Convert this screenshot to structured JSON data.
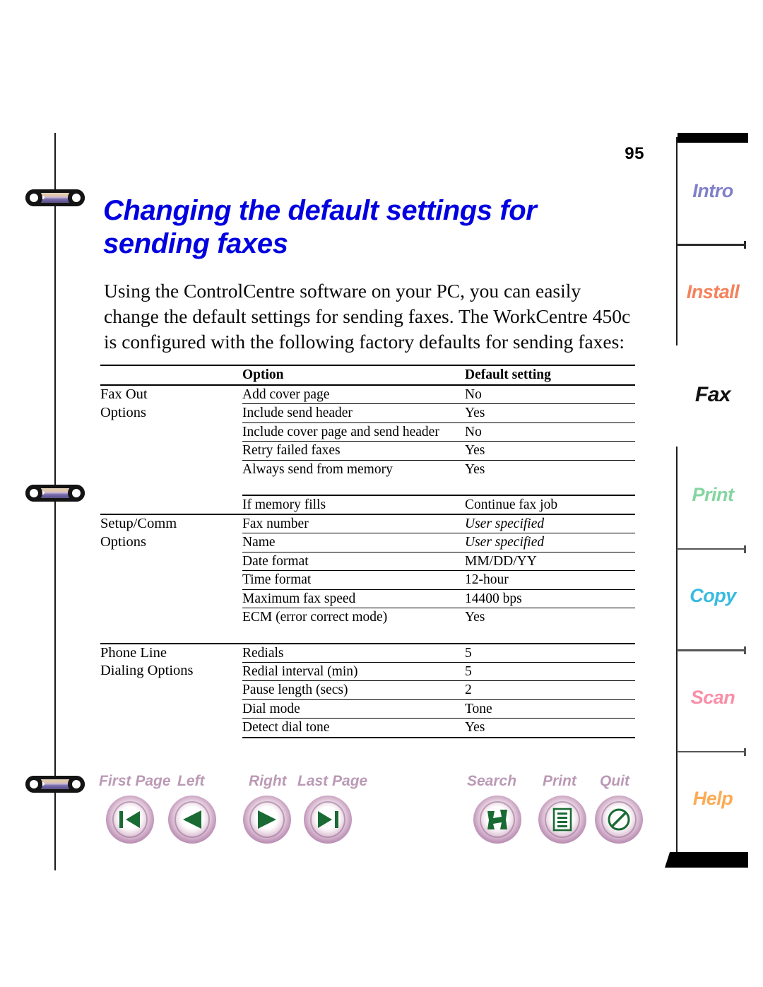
{
  "page": {
    "number": "95",
    "title_line1": "Changing the default settings for",
    "title_line2": "sending faxes",
    "intro": "Using the ControlCentre software on your PC, you can easily change the default settings for sending faxes. The WorkCentre 450c is configured with the following factory defaults for sending faxes:",
    "title_color": "#0000E0"
  },
  "table": {
    "headers": [
      "",
      "Option",
      "Default setting"
    ],
    "groups": [
      {
        "label_line1": "Fax Out",
        "label_line2": "Options",
        "rows": [
          {
            "option": "Add cover page",
            "default": "No",
            "italic": false
          },
          {
            "option": "Include send header",
            "default": "Yes",
            "italic": false
          },
          {
            "option": "Include cover page and send header",
            "default": "No",
            "italic": false
          },
          {
            "option": "Retry failed faxes",
            "default": "Yes",
            "italic": false
          },
          {
            "option": "Always send from memory",
            "default": "Yes",
            "italic": false
          }
        ]
      },
      {
        "label_line1": "",
        "label_line2": "",
        "rows": [
          {
            "option": "If memory fills",
            "default": "Continue fax job",
            "italic": false
          }
        ]
      },
      {
        "label_line1": "Setup/Comm",
        "label_line2": "Options",
        "rows": [
          {
            "option": "Fax number",
            "default": "User specified",
            "italic": true
          },
          {
            "option": "Name",
            "default": "User specified",
            "italic": true
          },
          {
            "option": "Date format",
            "default": "MM/DD/YY",
            "italic": false
          },
          {
            "option": "Time format",
            "default": "12-hour",
            "italic": false
          },
          {
            "option": "Maximum fax speed",
            "default": "14400 bps",
            "italic": false
          },
          {
            "option": "ECM (error correct mode)",
            "default": "Yes",
            "italic": false
          }
        ]
      },
      {
        "label_line1": "Phone Line",
        "label_line2": "Dialing Options",
        "rows": [
          {
            "option": "Redials",
            "default": "5",
            "italic": false
          },
          {
            "option": "Redial interval (min)",
            "default": "5",
            "italic": false
          },
          {
            "option": "Pause length (secs)",
            "default": "2",
            "italic": false
          },
          {
            "option": "Dial mode",
            "default": "Tone",
            "italic": false
          },
          {
            "option": "Detect dial tone",
            "default": "Yes",
            "italic": false
          }
        ]
      }
    ]
  },
  "nav": {
    "label_color": "#bb9ab6",
    "glyph_color": "#1a6b33",
    "buttons": [
      {
        "label": "First Page",
        "icon": "first-page-icon"
      },
      {
        "label": "Left",
        "icon": "previous-page-icon"
      },
      {
        "label": "Right",
        "icon": "next-page-icon"
      },
      {
        "label": "Last Page",
        "icon": "last-page-icon"
      },
      {
        "label": "Search",
        "icon": "search-binoculars-icon"
      },
      {
        "label": "Print",
        "icon": "print-document-icon"
      },
      {
        "label": "Quit",
        "icon": "quit-no-entry-icon"
      }
    ]
  },
  "tabs": [
    {
      "label": "Intro",
      "color": "#8080c8",
      "active": false
    },
    {
      "label": "Install",
      "color": "#f4825c",
      "active": false
    },
    {
      "label": "Fax",
      "color": "#111111",
      "active": true
    },
    {
      "label": "Print",
      "color": "#84d6a0",
      "active": false
    },
    {
      "label": "Copy",
      "color": "#38bbe0",
      "active": false
    },
    {
      "label": "Scan",
      "color": "#f98fa8",
      "active": false
    },
    {
      "label": "Help",
      "color": "#fbab54",
      "active": false
    }
  ]
}
